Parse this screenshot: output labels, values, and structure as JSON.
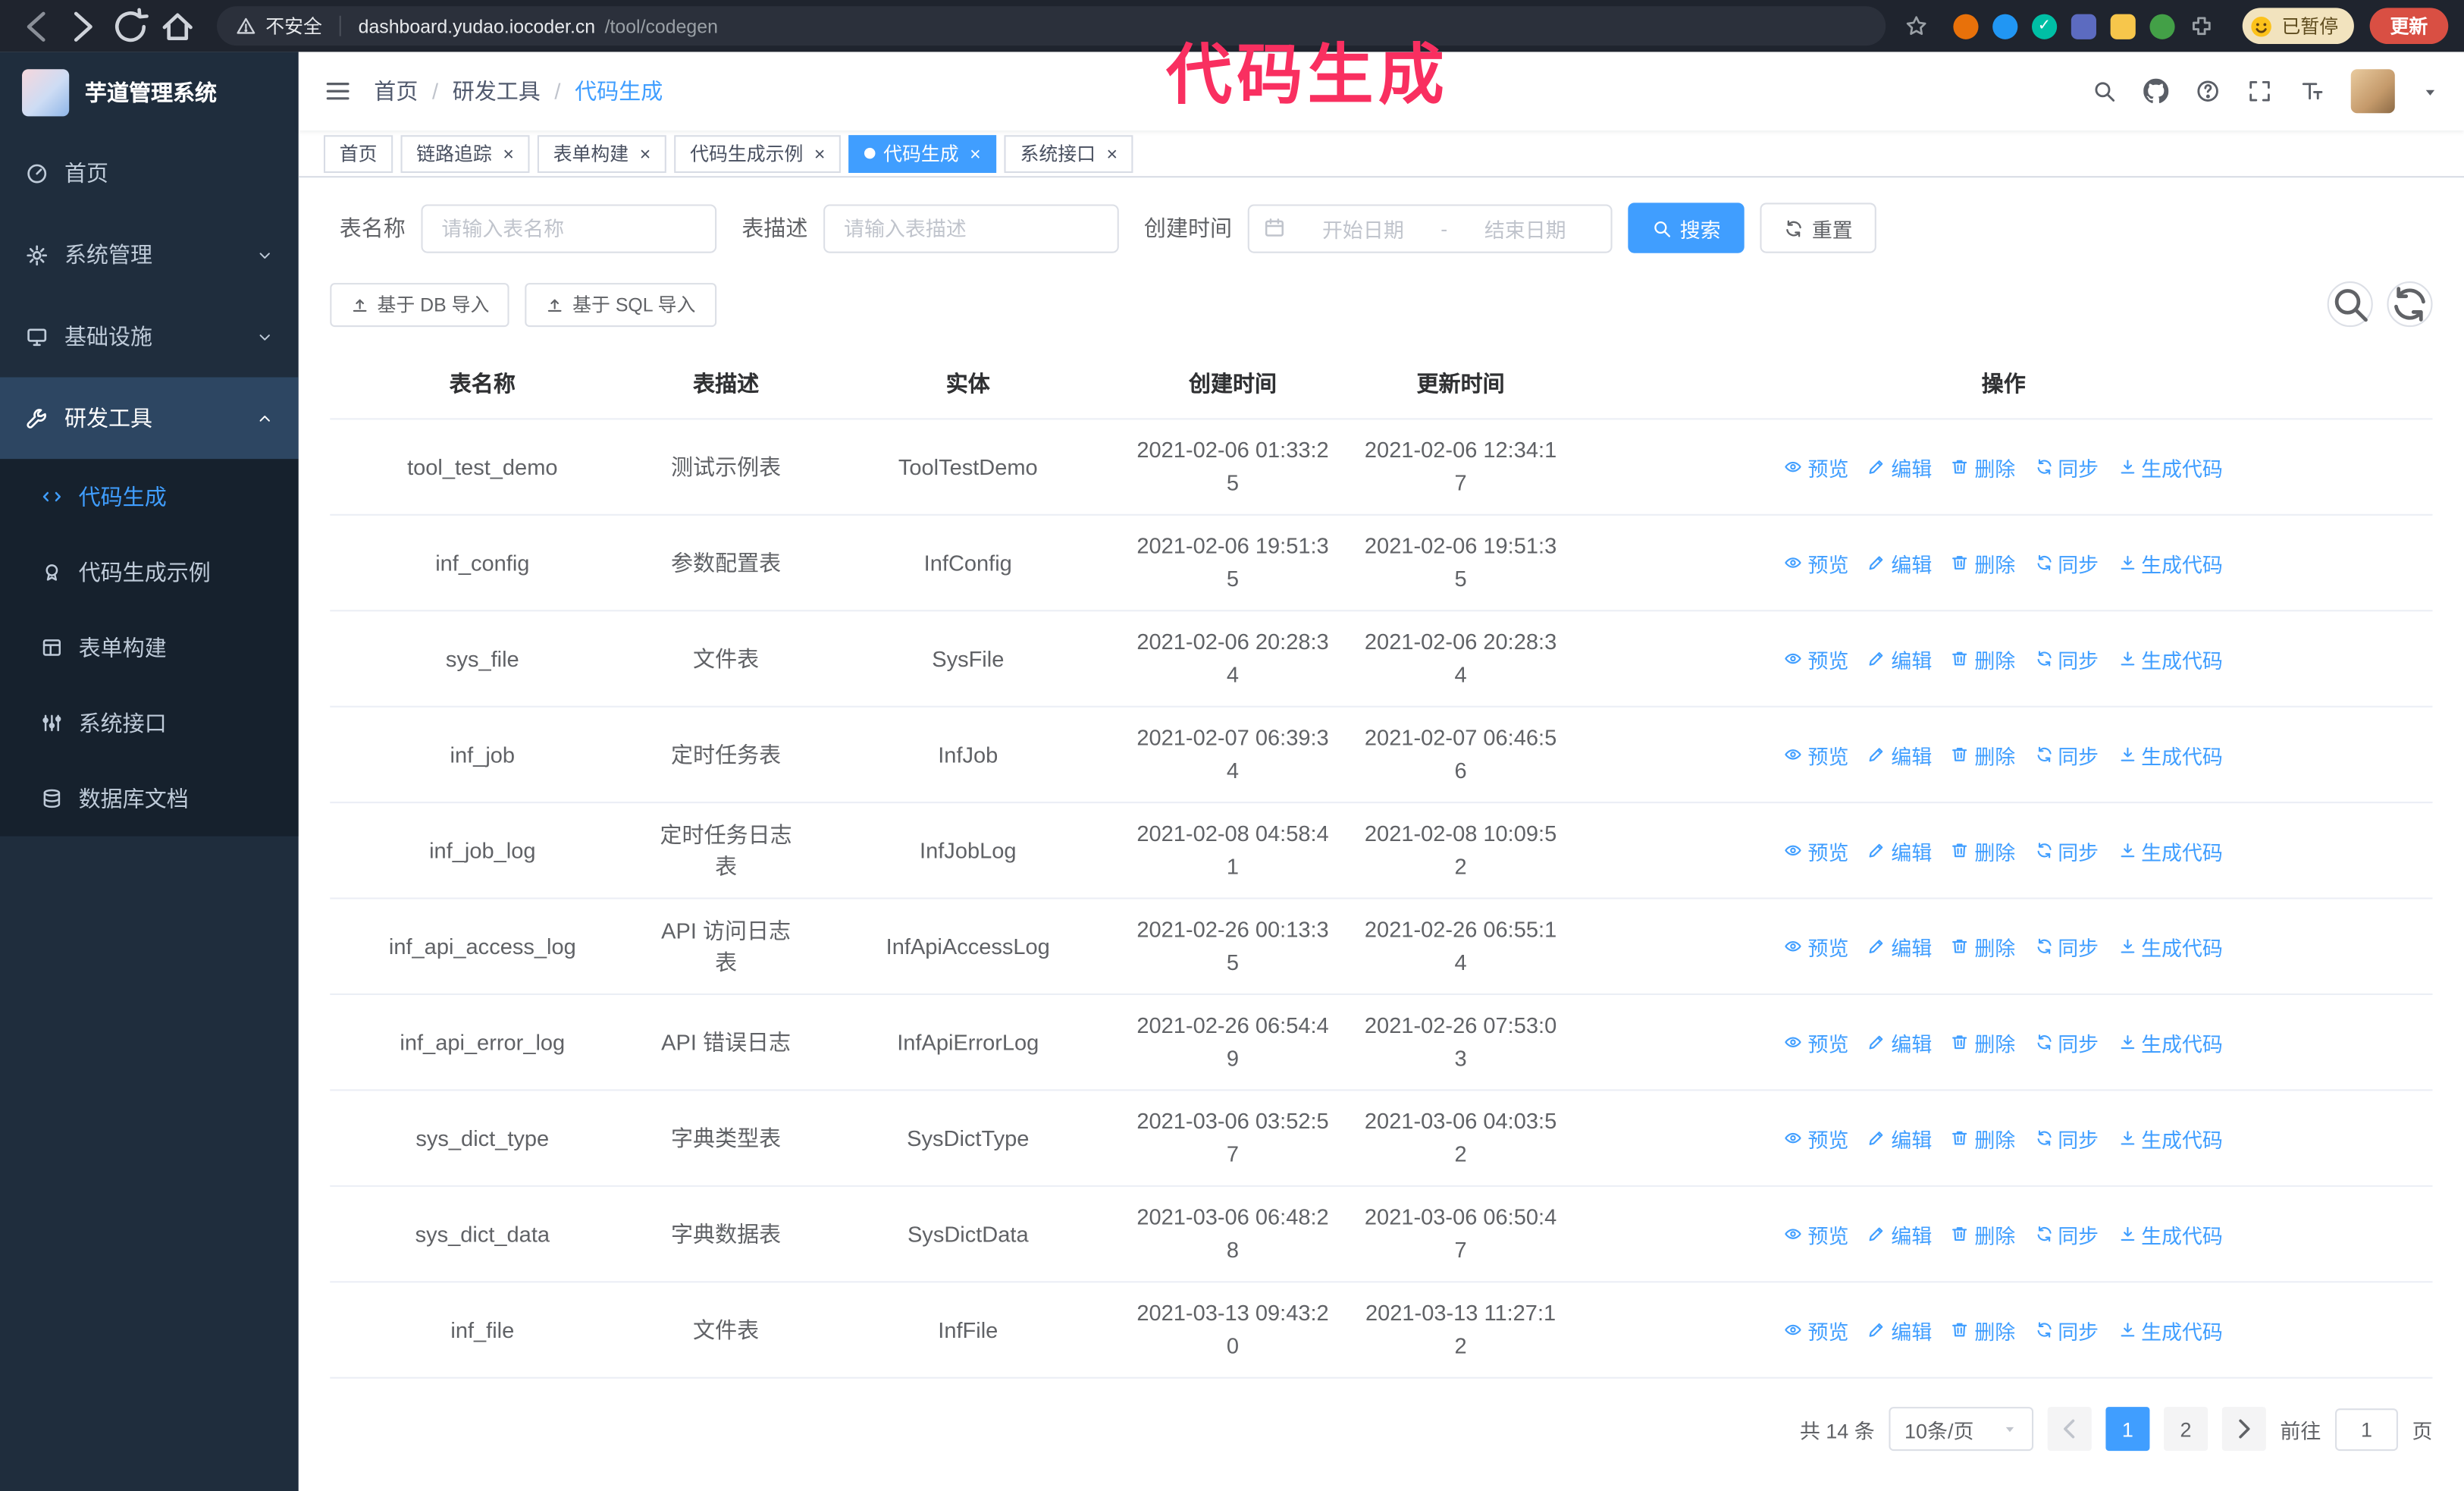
{
  "browser": {
    "security_label": "不安全",
    "url_domain": "dashboard.yudao.iocoder.cn",
    "url_path": "/tool/codegen",
    "paused_badge": "已暂停",
    "update_button": "更新",
    "extensions": [
      {
        "name": "fox-extension-icon",
        "color": "#E8710A",
        "shape": "circle",
        "glyph": ""
      },
      {
        "name": "drop-extension-icon",
        "color": "#2196F3",
        "shape": "circle",
        "glyph": ""
      },
      {
        "name": "check-extension-icon",
        "color": "#00BFA5",
        "shape": "circle",
        "glyph": "✓"
      },
      {
        "name": "people-extension-icon",
        "color": "#5C6BC0",
        "shape": "square",
        "glyph": ""
      },
      {
        "name": "dict-extension-icon",
        "color": "#F7C64B",
        "shape": "square",
        "glyph": ""
      },
      {
        "name": "leaf-extension-icon",
        "color": "#43A047",
        "shape": "circle",
        "glyph": ""
      },
      {
        "name": "puzzle-extension-icon",
        "color": "#9AA0A6",
        "shape": "puzzle",
        "glyph": ""
      }
    ]
  },
  "annotation": {
    "text": "代码生成",
    "color": "#F92F60"
  },
  "sidebar": {
    "logo_title": "芋道管理系统",
    "items": [
      {
        "label": "首页",
        "icon": "dashboard-icon"
      },
      {
        "label": "系统管理",
        "icon": "gear-icon",
        "chevron": "down"
      },
      {
        "label": "基础设施",
        "icon": "infra-icon",
        "chevron": "down"
      },
      {
        "label": "研发工具",
        "icon": "tools-icon",
        "chevron": "up",
        "highlight": true
      }
    ],
    "submenu": [
      {
        "label": "代码生成",
        "icon": "code-icon",
        "active": true
      },
      {
        "label": "代码生成示例",
        "icon": "example-icon"
      },
      {
        "label": "表单构建",
        "icon": "form-icon"
      },
      {
        "label": "系统接口",
        "icon": "api-icon"
      },
      {
        "label": "数据库文档",
        "icon": "database-icon"
      }
    ]
  },
  "header": {
    "breadcrumb": [
      "首页",
      "研发工具",
      "代码生成"
    ],
    "breadcrumb_separator": "/"
  },
  "tabs": [
    {
      "label": "首页",
      "closable": false,
      "active": false
    },
    {
      "label": "链路追踪",
      "closable": true,
      "active": false
    },
    {
      "label": "表单构建",
      "closable": true,
      "active": false
    },
    {
      "label": "代码生成示例",
      "closable": true,
      "active": false
    },
    {
      "label": "代码生成",
      "closable": true,
      "active": true
    },
    {
      "label": "系统接口",
      "closable": true,
      "active": false
    }
  ],
  "filters": {
    "table_name_label": "表名称",
    "table_name_placeholder": "请输入表名称",
    "table_desc_label": "表描述",
    "table_desc_placeholder": "请输入表描述",
    "create_time_label": "创建时间",
    "date_start_placeholder": "开始日期",
    "date_separator": "-",
    "date_end_placeholder": "结束日期",
    "search_button": "搜索",
    "reset_button": "重置"
  },
  "toolbar": {
    "import_db": "基于 DB 导入",
    "import_sql": "基于 SQL 导入"
  },
  "table": {
    "columns": [
      "表名称",
      "表描述",
      "实体",
      "创建时间",
      "更新时间",
      "操作"
    ],
    "actions": [
      {
        "key": "preview",
        "label": "预览",
        "icon": "eye-icon"
      },
      {
        "key": "edit",
        "label": "编辑",
        "icon": "edit-icon"
      },
      {
        "key": "delete",
        "label": "删除",
        "icon": "delete-icon"
      },
      {
        "key": "sync",
        "label": "同步",
        "icon": "sync-icon"
      },
      {
        "key": "generate",
        "label": "生成代码",
        "icon": "download-icon"
      }
    ],
    "rows": [
      {
        "name": "tool_test_demo",
        "desc": "测试示例表",
        "entity": "ToolTestDemo",
        "created": "2021-02-06 01:33:25",
        "updated": "2021-02-06 12:34:17"
      },
      {
        "name": "inf_config",
        "desc": "参数配置表",
        "entity": "InfConfig",
        "created": "2021-02-06 19:51:35",
        "updated": "2021-02-06 19:51:35"
      },
      {
        "name": "sys_file",
        "desc": "文件表",
        "entity": "SysFile",
        "created": "2021-02-06 20:28:34",
        "updated": "2021-02-06 20:28:34"
      },
      {
        "name": "inf_job",
        "desc": "定时任务表",
        "entity": "InfJob",
        "created": "2021-02-07 06:39:34",
        "updated": "2021-02-07 06:46:56"
      },
      {
        "name": "inf_job_log",
        "desc": "定时任务日志表",
        "entity": "InfJobLog",
        "created": "2021-02-08 04:58:41",
        "updated": "2021-02-08 10:09:52"
      },
      {
        "name": "inf_api_access_log",
        "desc": "API 访问日志表",
        "entity": "InfApiAccessLog",
        "created": "2021-02-26 00:13:35",
        "updated": "2021-02-26 06:55:14"
      },
      {
        "name": "inf_api_error_log",
        "desc": "API 错误日志",
        "entity": "InfApiErrorLog",
        "created": "2021-02-26 06:54:49",
        "updated": "2021-02-26 07:53:03"
      },
      {
        "name": "sys_dict_type",
        "desc": "字典类型表",
        "entity": "SysDictType",
        "created": "2021-03-06 03:52:57",
        "updated": "2021-03-06 04:03:52"
      },
      {
        "name": "sys_dict_data",
        "desc": "字典数据表",
        "entity": "SysDictData",
        "created": "2021-03-06 06:48:28",
        "updated": "2021-03-06 06:50:47"
      },
      {
        "name": "inf_file",
        "desc": "文件表",
        "entity": "InfFile",
        "created": "2021-03-13 09:43:20",
        "updated": "2021-03-13 11:27:12"
      }
    ]
  },
  "pagination": {
    "total": "共 14 条",
    "page_size": "10条/页",
    "pages": [
      "1",
      "2"
    ],
    "active_page": "1",
    "goto_label": "前往",
    "goto_value": "1",
    "goto_unit": "页"
  },
  "colors": {
    "accent": "#409EFF",
    "sidebar_bg": "#1F2D3D",
    "submenu_bg": "#16212D",
    "annotation": "#F92F60"
  }
}
